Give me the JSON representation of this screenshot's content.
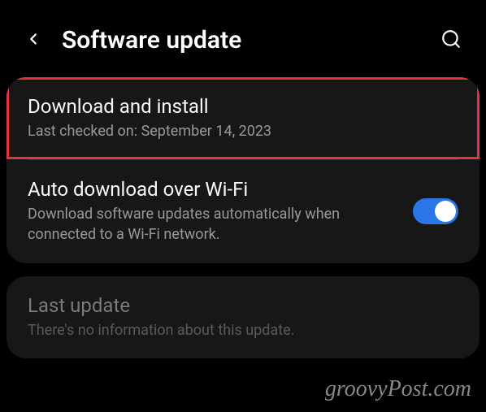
{
  "header": {
    "title": "Software update"
  },
  "items": {
    "download": {
      "title": "Download and install",
      "subtitle": "Last checked on: September 14, 2023"
    },
    "auto": {
      "title": "Auto download over Wi-Fi",
      "subtitle": "Download software updates automatically when connected to a Wi-Fi network.",
      "toggle_on": true
    },
    "last_update": {
      "title": "Last update",
      "subtitle": "There's no information about this update."
    }
  },
  "watermark": "groovyPost.com"
}
